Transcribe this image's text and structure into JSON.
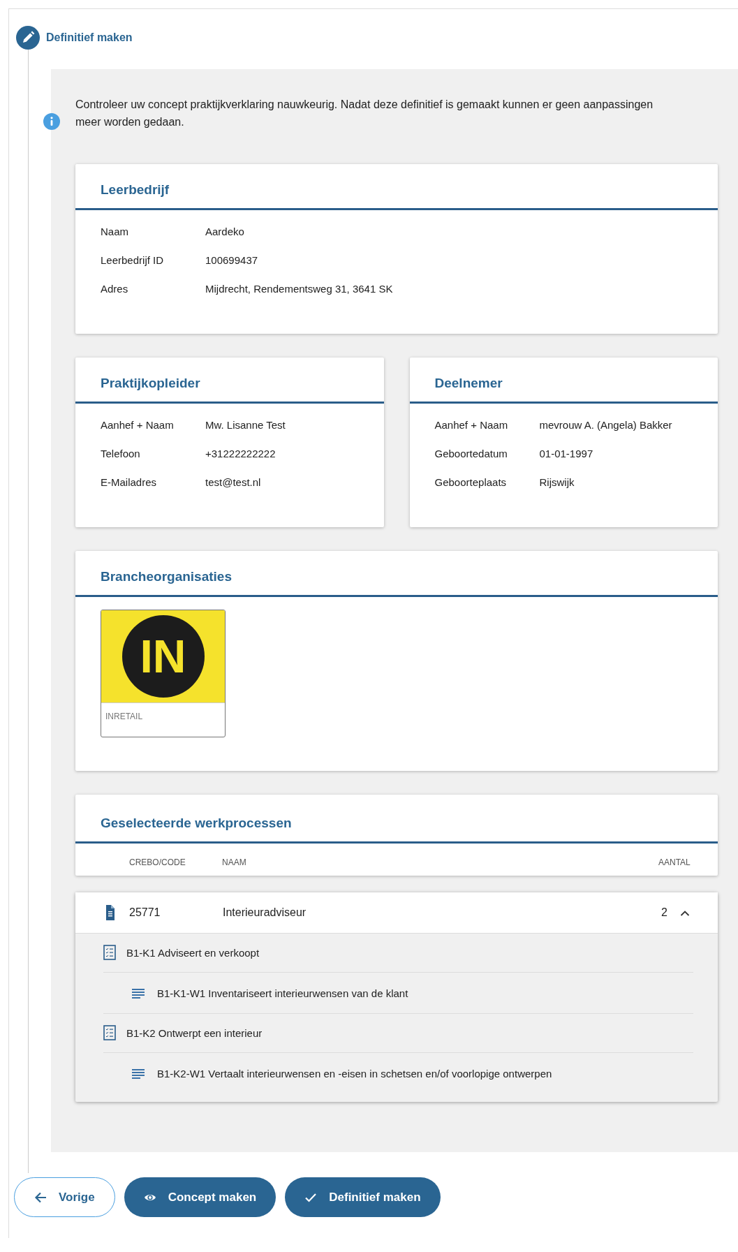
{
  "step": {
    "title": "Definitief maken"
  },
  "info": "Controleer uw concept praktijkverklaring nauwkeurig. Nadat deze definitief is gemaakt kunnen er geen aanpassingen meer worden gedaan.",
  "leerbedrijf": {
    "title": "Leerbedrijf",
    "fields": [
      {
        "label": "Naam",
        "value": "Aardeko"
      },
      {
        "label": "Leerbedrijf ID",
        "value": "100699437"
      },
      {
        "label": "Adres",
        "value": "Mijdrecht, Rendementsweg 31, 3641 SK"
      }
    ]
  },
  "praktijkopleider": {
    "title": "Praktijkopleider",
    "fields": [
      {
        "label": "Aanhef + Naam",
        "value": "Mw. Lisanne Test"
      },
      {
        "label": "Telefoon",
        "value": "+31222222222"
      },
      {
        "label": "E-Mailadres",
        "value": "test@test.nl"
      }
    ]
  },
  "deelnemer": {
    "title": "Deelnemer",
    "fields": [
      {
        "label": "Aanhef + Naam",
        "value": "mevrouw A. (Angela) Bakker"
      },
      {
        "label": "Geboortedatum",
        "value": "01-01-1997"
      },
      {
        "label": "Geboorteplaats",
        "value": "Rijswijk"
      }
    ]
  },
  "brancheorganisaties": {
    "title": "Brancheorganisaties",
    "items": [
      {
        "logo_text": "IN",
        "name": "INRETAIL"
      }
    ]
  },
  "werkprocessen": {
    "title": "Geselecteerde werkprocessen",
    "columns": [
      "CREBO/CODE",
      "NAAM",
      "AANTAL"
    ],
    "items": [
      {
        "code": "25771",
        "name": "Interieuradviseur",
        "count": "2",
        "expanded": true,
        "children": [
          {
            "label": "B1-K1 Adviseert en verkoopt",
            "children": [
              {
                "label": "B1-K1-W1 Inventariseert interieurwensen van de klant"
              }
            ]
          },
          {
            "label": "B1-K2 Ontwerpt een interieur",
            "children": [
              {
                "label": "B1-K2-W1 Vertaalt interieurwensen en -eisen in schetsen en/of voorlopige ontwerpen"
              }
            ]
          }
        ]
      }
    ]
  },
  "buttons": [
    {
      "label": "Vorige",
      "kind": "back"
    },
    {
      "label": "Concept maken",
      "kind": "concept"
    },
    {
      "label": "Definitief maken",
      "kind": "final"
    }
  ]
}
